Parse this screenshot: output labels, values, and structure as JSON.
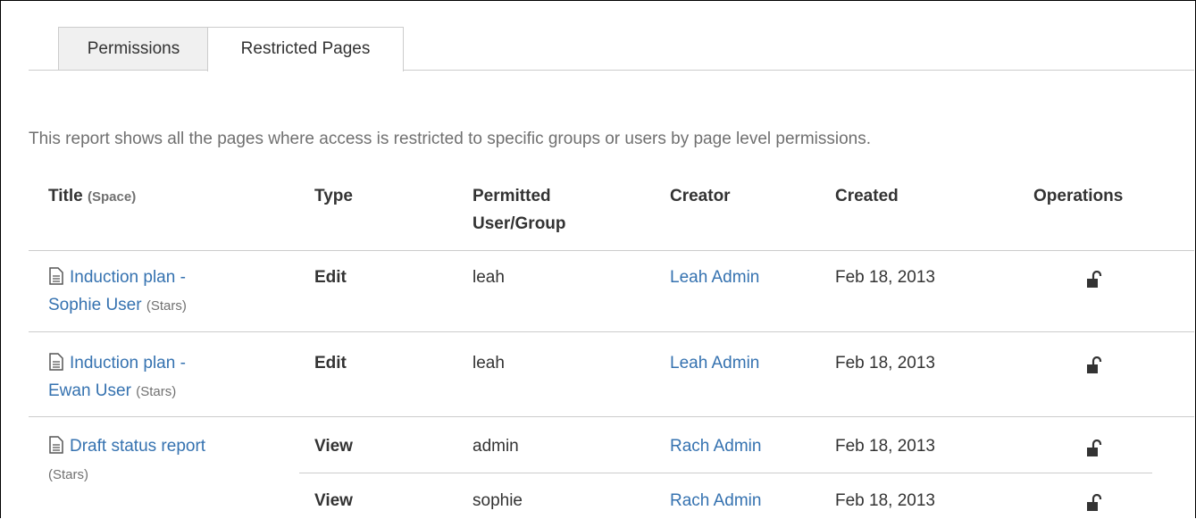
{
  "tabs": [
    {
      "label": "Permissions",
      "active": false
    },
    {
      "label": "Restricted Pages",
      "active": true
    }
  ],
  "description": "This report shows all the pages where access is restricted to specific groups or users by page level permissions.",
  "table": {
    "headers": {
      "title": "Title",
      "title_small": "(Space)",
      "type": "Type",
      "permitted_line1": "Permitted",
      "permitted_line2": "User/Group",
      "creator": "Creator",
      "created": "Created",
      "operations": "Operations"
    },
    "rows": [
      {
        "title_line1": "Induction plan -",
        "title_line2": "Sophie User",
        "space": "(Stars)",
        "type": "Edit",
        "permitted": "leah",
        "creator": "Leah Admin",
        "created": "Feb 18, 2013",
        "operation_icon": "unlock-icon"
      },
      {
        "title_line1": "Induction plan -",
        "title_line2": "Ewan User",
        "space": "(Stars)",
        "type": "Edit",
        "permitted": "leah",
        "creator": "Leah Admin",
        "created": "Feb 18, 2013",
        "operation_icon": "unlock-icon"
      },
      {
        "title_line1": "Draft status report",
        "space": "(Stars)",
        "restrictions": [
          {
            "type": "View",
            "permitted": "admin",
            "creator": "Rach Admin",
            "created": "Feb 18, 2013",
            "operation_icon": "unlock-icon"
          },
          {
            "type": "View",
            "permitted": "sophie",
            "creator": "Rach Admin",
            "created": "Feb 18, 2013",
            "operation_icon": "unlock-icon"
          }
        ]
      }
    ]
  },
  "colors": {
    "link": "#3572b0",
    "muted": "#707070",
    "border": "#cccccc"
  }
}
